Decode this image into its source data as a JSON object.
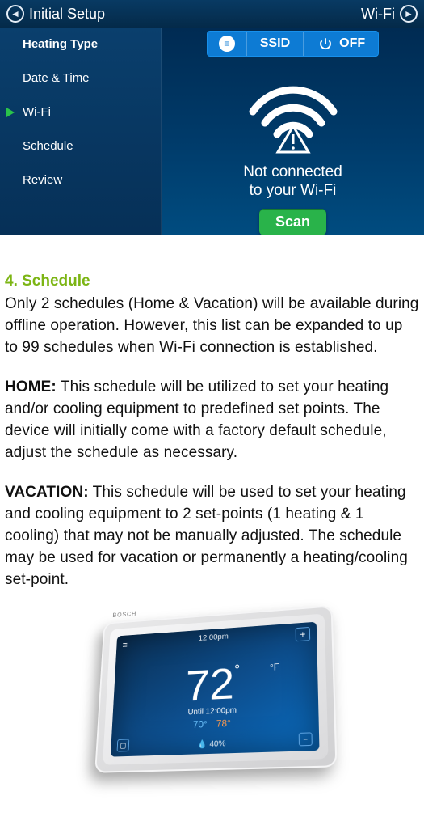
{
  "device": {
    "topbar": {
      "left": "Initial Setup",
      "right": "Wi-Fi"
    },
    "sidebar": {
      "items": [
        {
          "label": "Heating Type",
          "heading": true
        },
        {
          "label": "Date & Time"
        },
        {
          "label": "Wi-Fi",
          "active": true
        },
        {
          "label": "Schedule"
        },
        {
          "label": "Review"
        }
      ]
    },
    "pills": {
      "ssid": "SSID",
      "off": "OFF"
    },
    "status": {
      "line1": "Not connected",
      "line2": "to your Wi-Fi"
    },
    "scan_label": "Scan"
  },
  "doc": {
    "heading": "4. Schedule",
    "p1": "Only 2 schedules (Home & Vacation) will be available during offline operation. However, this list can be expanded to up to 99 schedules when Wi-Fi connection is established.",
    "p2_label": "HOME:",
    "p2": " This schedule will be utilized to set your heating and/or cooling equipment to predefined set points. The device will initially come with a factory default schedule, adjust the schedule as necessary.",
    "p3_label": "VACATION:",
    "p3": " This schedule will be used to set your heating and cooling equipment to 2 set-points (1 heating & 1 cooling) that may not be manually adjusted. The schedule may be used for vacation or permanently a heating/cooling set-point."
  },
  "thermo": {
    "brand": "BOSCH",
    "time": "12:00pm",
    "temp": "72",
    "deg": "°",
    "unit": "°F",
    "until": "Until 12:00pm",
    "cool": "70°",
    "heat": "78°",
    "humidity": "40%"
  }
}
